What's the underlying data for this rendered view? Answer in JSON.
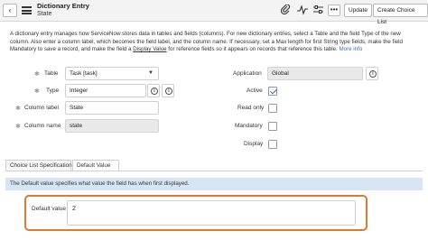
{
  "header": {
    "title": "Dictionary Entry",
    "subtitle": "State",
    "back_icon": "‹",
    "more_icon": "•••",
    "buttons": {
      "update": "Update",
      "create_choice_list": "Create Choice List"
    }
  },
  "info": {
    "text_1": "A dictionary entry manages how ServiceNow stores data in tables and fields (columns). For new dictionary entries, select a Table and the field Type of the new column. Also enter a column label, which becomes the field label, and the column name. If necessary, set a Max length for first String type fields, make the field Mandatory to save a record, and make the field a ",
    "display_value": "Display Value",
    "text_2": " for reference fields so it appears on records that reference this table. ",
    "more_info": "More info"
  },
  "form": {
    "table": {
      "label": "Table",
      "value": "Task [task]"
    },
    "type": {
      "label": "Type",
      "value": "Integer"
    },
    "column_label": {
      "label": "Column label",
      "value": "State"
    },
    "column_name": {
      "label": "Column name",
      "value": "state"
    },
    "application": {
      "label": "Application",
      "value": "Global"
    },
    "active": {
      "label": "Active",
      "checked": true
    },
    "read_only": {
      "label": "Read only",
      "checked": false
    },
    "mandatory": {
      "label": "Mandatory",
      "checked": false
    },
    "display": {
      "label": "Display",
      "checked": false
    }
  },
  "tabs": [
    {
      "label": "Choice List Specification",
      "active": false
    },
    {
      "label": "Default Value",
      "active": true
    }
  ],
  "default_value_section": {
    "notice": "The Default value specifies what value the field has when first displayed.",
    "label": "Default value",
    "value": "2"
  },
  "colors": {
    "highlight": "#e0782f",
    "notice_bg": "#d7e6f5",
    "checkmark": "#2f6fb6"
  }
}
